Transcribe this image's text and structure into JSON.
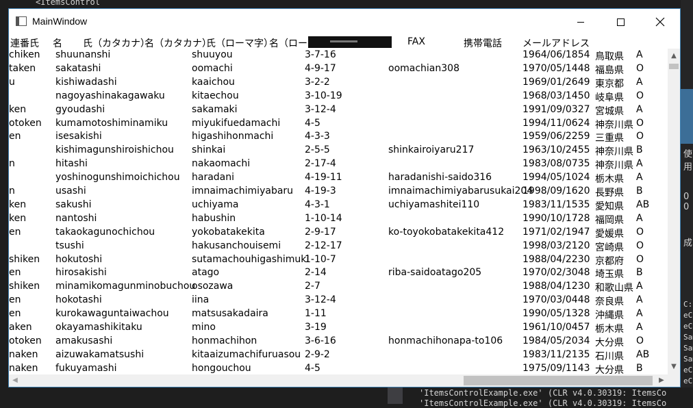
{
  "background": {
    "editor_snippet": "<ItemsControl",
    "right_side_texts": [
      "使用",
      "0 0",
      "成"
    ],
    "console_lines": [
      "'ItemsControlExample.exe' (CLR v4.0.30319: ItemsCo",
      "'ItemsControlExample.exe' (CLR v4.0.30319: ItemsCo"
    ],
    "side_panel_lines": [
      "C:\\",
      "eCo",
      "eCo",
      "Sam",
      "Sam",
      "Sam",
      "eCo",
      "eCo",
      "eCo"
    ]
  },
  "window": {
    "title": "MainWindow",
    "accent_color": "#3c7fb1",
    "caption_buttons": {
      "minimize": "minimize-icon",
      "maximize": "maximize-icon",
      "close": "close-icon"
    }
  },
  "table": {
    "headers": [
      "連番",
      "氏",
      "名",
      "氏（カタカナ）",
      "名（カタカナ）",
      "氏（ローマ字）",
      "名（ロー",
      "FAX",
      "携帯電話",
      "メールアドレス"
    ],
    "rows": [
      [
        "chiken",
        "shuunanshi",
        "shuuyou",
        "3-7-16",
        "",
        "1964/06/1854",
        "鳥取県",
        "A"
      ],
      [
        "taken",
        "sakatashi",
        "oomachi",
        "4-9-17",
        "oomachian308",
        "1970/05/1448",
        "福島県",
        "O"
      ],
      [
        "u",
        "kishiwadashi",
        "kaaichou",
        "3-2-2",
        "",
        "1969/01/2649",
        "東京都",
        "A"
      ],
      [
        "",
        "nagoyashinakagawaku",
        "kitaechou",
        "3-10-19",
        "",
        "1968/03/1450",
        "岐阜県",
        "O"
      ],
      [
        "ken",
        "gyoudashi",
        "sakamaki",
        "3-12-4",
        "",
        "1991/09/0327",
        "宮城県",
        "A"
      ],
      [
        "otoken",
        "kumamotoshiminamiku",
        "miyukifuedamachi",
        "4-5",
        "",
        "1994/11/0624",
        "神奈川県",
        "O"
      ],
      [
        "en",
        "isesakishi",
        "higashihonmachi",
        "4-3-3",
        "",
        "1959/06/2259",
        "三重県",
        "O"
      ],
      [
        "",
        "kishimagunshiroishichou",
        "shinkai",
        "2-5-5",
        "shinkairoiyaru217",
        "1963/10/2455",
        "神奈川県",
        "B"
      ],
      [
        "n",
        "hitashi",
        "nakaomachi",
        "2-17-4",
        "",
        "1983/08/0735",
        "神奈川県",
        "A"
      ],
      [
        "",
        "yoshinogunshimoichichou",
        "haradani",
        "4-19-11",
        "haradanishi-saido316",
        "1994/05/1024",
        "栃木県",
        "A"
      ],
      [
        "n",
        "usashi",
        "imnaimachimiyabaru",
        "4-19-3",
        "imnaimachimiyabarusukai204",
        "1998/09/1620",
        "長野県",
        "B"
      ],
      [
        "ken",
        "sakushi",
        "uchiyama",
        "4-3-1",
        "uchiyamashitei110",
        "1983/11/1535",
        "愛知県",
        "AB"
      ],
      [
        "ken",
        "nantoshi",
        "habushin",
        "1-10-14",
        "",
        "1990/10/1728",
        "福岡県",
        "A"
      ],
      [
        "en",
        "takaokagunochichou",
        "yokobatakekita",
        "2-9-17",
        "ko-toyokobatakekita412",
        "1971/02/1947",
        "愛媛県",
        "O"
      ],
      [
        "",
        "tsushi",
        "hakusanchouisemi",
        "2-12-17",
        "",
        "1998/03/2120",
        "宮崎県",
        "O"
      ],
      [
        "shiken",
        "hokutoshi",
        "sutamachouhigashimuki",
        "1-10-7",
        "",
        "1988/04/2230",
        "京都府",
        "O"
      ],
      [
        "en",
        "hirosakishi",
        "atago",
        "2-14",
        "riba-saidoatago205",
        "1970/02/3048",
        "埼玉県",
        "B"
      ],
      [
        "shiken",
        "minamikomagunminobuchou",
        "osozawa",
        "2-7",
        "",
        "1988/04/1230",
        "和歌山県",
        "A"
      ],
      [
        "en",
        "hokotashi",
        "iina",
        "3-12-4",
        "",
        "1970/03/0448",
        "奈良県",
        "A"
      ],
      [
        "en",
        "kurokawaguntaiwachou",
        "matsusakadaira",
        "1-11",
        "",
        "1990/05/1328",
        "沖縄県",
        "A"
      ],
      [
        "aken",
        "okayamashikitaku",
        "mino",
        "3-19",
        "",
        "1961/10/0457",
        "栃木県",
        "A"
      ],
      [
        "otoken",
        "amakusashi",
        "honmachihon",
        "3-6-16",
        "honmachihonapa-to106",
        "1984/05/2034",
        "大分県",
        "O"
      ],
      [
        "naken",
        "aizuwakamatsushi",
        "kitaaizumachifuruasou",
        "2-9-2",
        "",
        "1983/11/2135",
        "石川県",
        "AB"
      ],
      [
        "naken",
        "fukuyamashi",
        "hongouchou",
        "4-5",
        "",
        "1975/09/1143",
        "大分県",
        "B"
      ]
    ]
  }
}
